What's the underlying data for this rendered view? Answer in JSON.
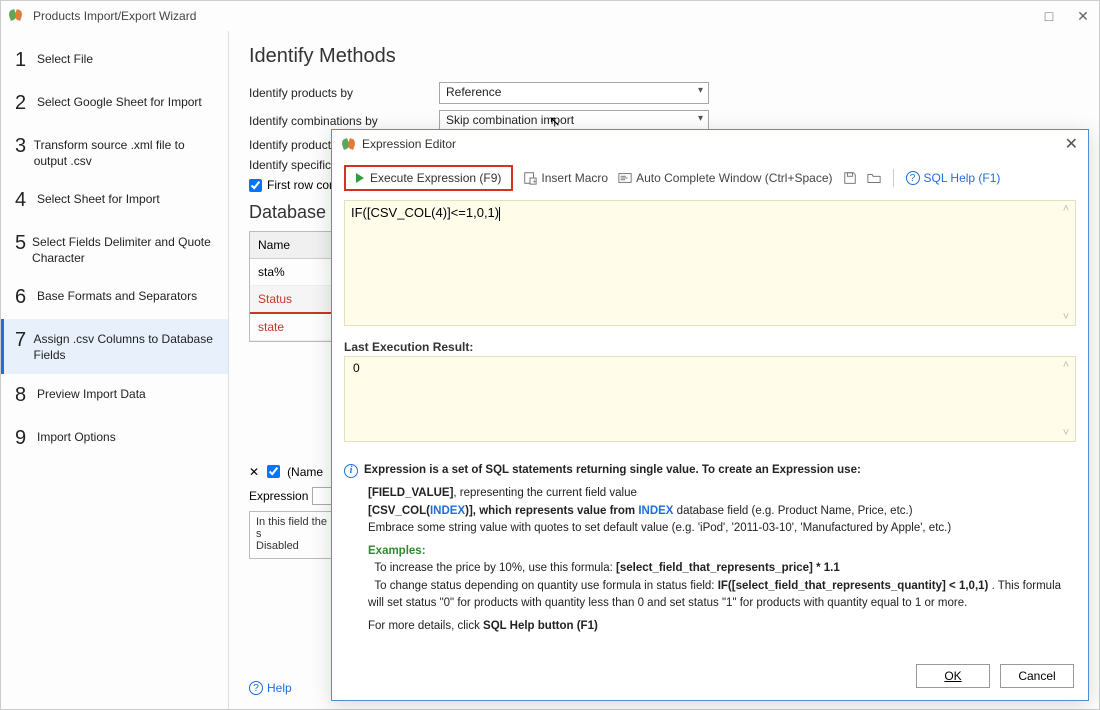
{
  "window": {
    "title": "Products Import/Export Wizard"
  },
  "sidebar": {
    "steps": [
      {
        "num": "1",
        "label": "Select File"
      },
      {
        "num": "2",
        "label": "Select Google Sheet for Import"
      },
      {
        "num": "3",
        "label": "Transform source .xml file to output .csv"
      },
      {
        "num": "4",
        "label": "Select Sheet for Import"
      },
      {
        "num": "5",
        "label": "Select Fields Delimiter and Quote Character"
      },
      {
        "num": "6",
        "label": "Base Formats and Separators"
      },
      {
        "num": "7",
        "label": "Assign .csv Columns to Database Fields"
      },
      {
        "num": "8",
        "label": "Preview Import Data"
      },
      {
        "num": "9",
        "label": "Import Options"
      }
    ]
  },
  "main": {
    "heading": "Identify Methods",
    "rows": {
      "products_by_label": "Identify products by",
      "products_by_value": "Reference",
      "combinations_by_label": "Identify combinations by",
      "combinations_by_value": "Skip combination import",
      "product_features_label_truncated": "Identify product",
      "specific_prices_label_truncated": "Identify specific"
    },
    "first_row_label": "First row con",
    "database_heading_truncated": "Database F",
    "table": {
      "header": "Name",
      "filter": "sta%",
      "rows": [
        "Status",
        "state"
      ]
    },
    "under": {
      "name_fragment": "(Name",
      "expression_label": "Expression",
      "desc_line1": "In this field the s",
      "desc_line2": "Disabled"
    },
    "help_label": "Help"
  },
  "dialog": {
    "title": "Expression Editor",
    "toolbar": {
      "execute": "Execute Expression (F9)",
      "insert_macro": "Insert Macro",
      "auto_complete": "Auto Complete Window (Ctrl+Space)",
      "sql_help": "SQL Help (F1)"
    },
    "code": "IF([CSV_COL(4)]<=1,0,1)",
    "last_exec_label": "Last Execution Result:",
    "result": "0",
    "help": {
      "intro": "Expression is a set of SQL statements returning single value. To create an Expression use:",
      "field_value_pre": "[FIELD_VALUE]",
      "field_value_post": ", representing the current field value",
      "csv_col_pre": "[CSV_COL(",
      "csv_col_idx": "INDEX",
      "csv_col_mid": ")], which represents value from ",
      "csv_col_post": " database field (e.g. Product Name, Price, etc.)",
      "embrace": "Embrace some string value with quotes to set default value (e.g. 'iPod', '2011-03-10', 'Manufactured by Apple', etc.)",
      "examples_label": "Examples:",
      "ex1_pre": "To increase the price by 10%, use this formula: ",
      "ex1_bold": "[select_field_that_represents_price] * 1.1",
      "ex2_pre": "To change status depending on quantity use formula in status field: ",
      "ex2_bold": "IF([select_field_that_represents_quantity] < 1,0,1)",
      "ex2_post": " . This formula will set status \"0\" for products with quantity less than 0 and set status \"1\" for products with quantity equal to 1 or more.",
      "more_pre": "For more details, click ",
      "more_bold": "SQL Help button (F1)"
    },
    "buttons": {
      "ok": "OK",
      "cancel": "Cancel"
    }
  }
}
